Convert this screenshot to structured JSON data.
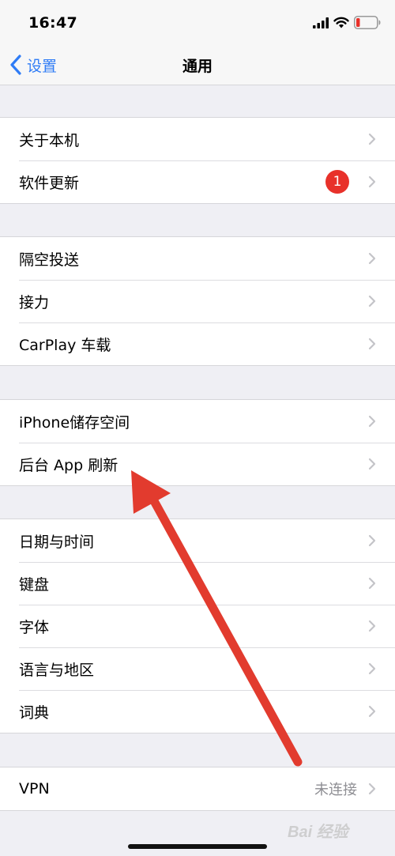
{
  "status_bar": {
    "time": "16:47"
  },
  "nav": {
    "back_label": "设置",
    "title": "通用"
  },
  "groups": [
    {
      "rows": [
        {
          "label": "关于本机"
        },
        {
          "label": "软件更新",
          "badge": "1"
        }
      ]
    },
    {
      "rows": [
        {
          "label": "隔空投送"
        },
        {
          "label": "接力"
        },
        {
          "label": "CarPlay 车载"
        }
      ]
    },
    {
      "rows": [
        {
          "label": "iPhone储存空间"
        },
        {
          "label": "后台 App 刷新"
        }
      ]
    },
    {
      "rows": [
        {
          "label": "日期与时间"
        },
        {
          "label": "键盘"
        },
        {
          "label": "字体"
        },
        {
          "label": "语言与地区"
        },
        {
          "label": "词典"
        }
      ]
    },
    {
      "rows": [
        {
          "label": "VPN",
          "detail": "未连接"
        }
      ]
    }
  ],
  "watermark": {
    "text": "Bai 经验"
  },
  "colors": {
    "accent": "#2f7cf6",
    "badge": "#e8312a",
    "arrow": "#e23b2e"
  }
}
